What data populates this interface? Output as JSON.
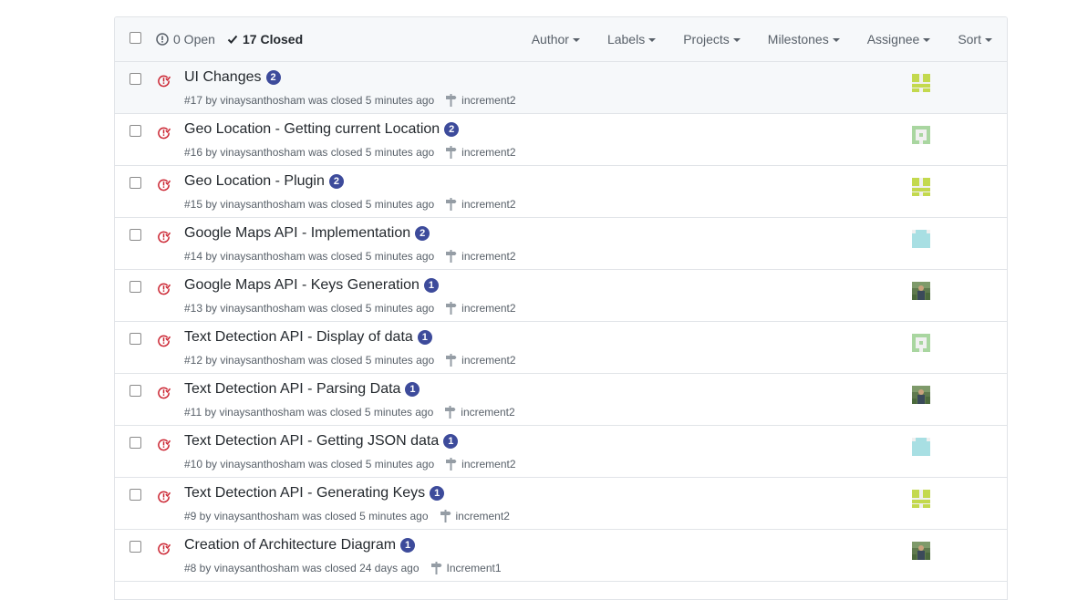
{
  "header": {
    "open_label": "0 Open",
    "closed_label": "17 Closed",
    "filters": [
      "Author",
      "Labels",
      "Projects",
      "Milestones",
      "Assignee",
      "Sort"
    ]
  },
  "colors": {
    "badge": "#3d4b9b",
    "closed_icon": "#cb2431"
  },
  "issues": [
    {
      "title": "UI Changes",
      "comments": "2",
      "meta": "#17 by vinaysanthosham was closed 5 minutes ago",
      "milestone": "increment2",
      "avatar": "identicon-lime-blocks",
      "highlighted": true
    },
    {
      "title": "Geo Location - Getting current Location",
      "comments": "2",
      "meta": "#16 by vinaysanthosham was closed 5 minutes ago",
      "milestone": "increment2",
      "avatar": "identicon-green-pattern"
    },
    {
      "title": "Geo Location - Plugin",
      "comments": "2",
      "meta": "#15 by vinaysanthosham was closed 5 minutes ago",
      "milestone": "increment2",
      "avatar": "identicon-lime-blocks"
    },
    {
      "title": "Google Maps API - Implementation",
      "comments": "2",
      "meta": "#14 by vinaysanthosham was closed 5 minutes ago",
      "milestone": "increment2",
      "avatar": "identicon-cyan"
    },
    {
      "title": "Google Maps API - Keys Generation",
      "comments": "1",
      "meta": "#13 by vinaysanthosham was closed 5 minutes ago",
      "milestone": "increment2",
      "avatar": "photo-avatar"
    },
    {
      "title": "Text Detection API - Display of data",
      "comments": "1",
      "meta": "#12 by vinaysanthosham was closed 5 minutes ago",
      "milestone": "increment2",
      "avatar": "identicon-green-pattern"
    },
    {
      "title": "Text Detection API - Parsing Data",
      "comments": "1",
      "meta": "#11 by vinaysanthosham was closed 5 minutes ago",
      "milestone": "increment2",
      "avatar": "photo-avatar"
    },
    {
      "title": "Text Detection API - Getting JSON data",
      "comments": "1",
      "meta": "#10 by vinaysanthosham was closed 5 minutes ago",
      "milestone": "increment2",
      "avatar": "identicon-cyan"
    },
    {
      "title": "Text Detection API - Generating Keys",
      "comments": "1",
      "meta": "#9 by vinaysanthosham was closed 5 minutes ago",
      "milestone": "increment2",
      "avatar": "identicon-lime-blocks"
    },
    {
      "title": "Creation of Architecture Diagram",
      "comments": "1",
      "meta": "#8 by vinaysanthosham was closed 24 days ago",
      "milestone": "Increment1",
      "avatar": "photo-avatar"
    }
  ]
}
